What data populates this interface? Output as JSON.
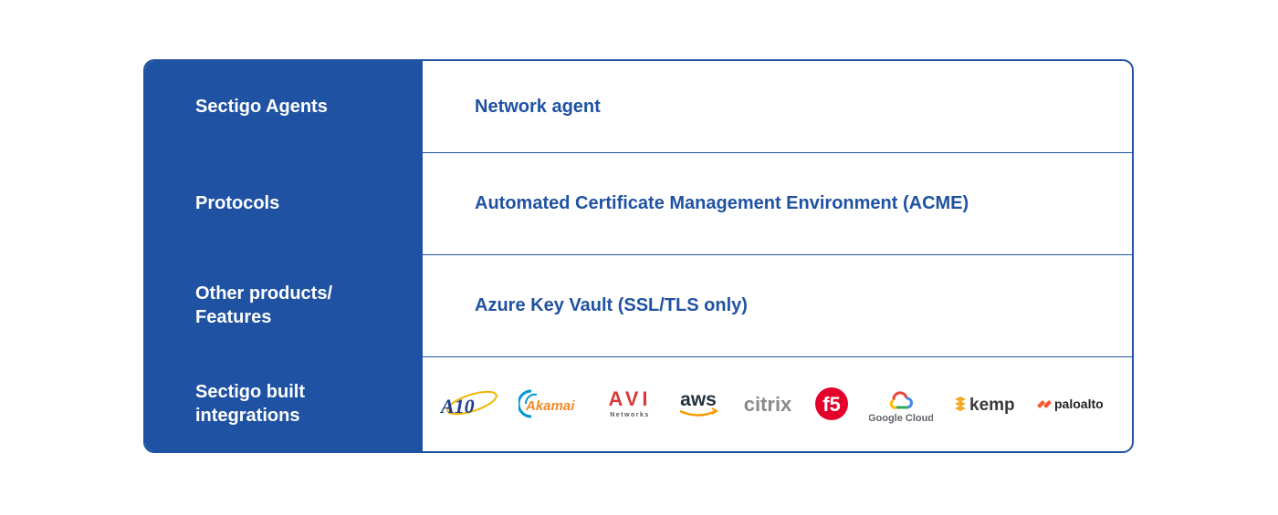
{
  "rows": [
    {
      "label": "Sectigo Agents",
      "value": "Network agent"
    },
    {
      "label": "Protocols",
      "value": "Automated Certificate Management Environment (ACME)"
    },
    {
      "label_line1": "Other products/",
      "label_line2": "Features",
      "value": "Azure Key Vault (SSL/TLS only)"
    },
    {
      "label_line1": "Sectigo built",
      "label_line2": "integrations"
    }
  ],
  "logos": {
    "a10": "A10",
    "akamai": "Akamai",
    "avi": "AVI",
    "avi_sub": "Networks",
    "aws": "aws",
    "citrix": "citrix",
    "f5": "f5",
    "google_cloud": "Google Cloud",
    "kemp": "kemp",
    "paloalto": "paloalto"
  },
  "colors": {
    "brand_blue": "#1f52a2",
    "text_blue": "#1f52a2"
  }
}
